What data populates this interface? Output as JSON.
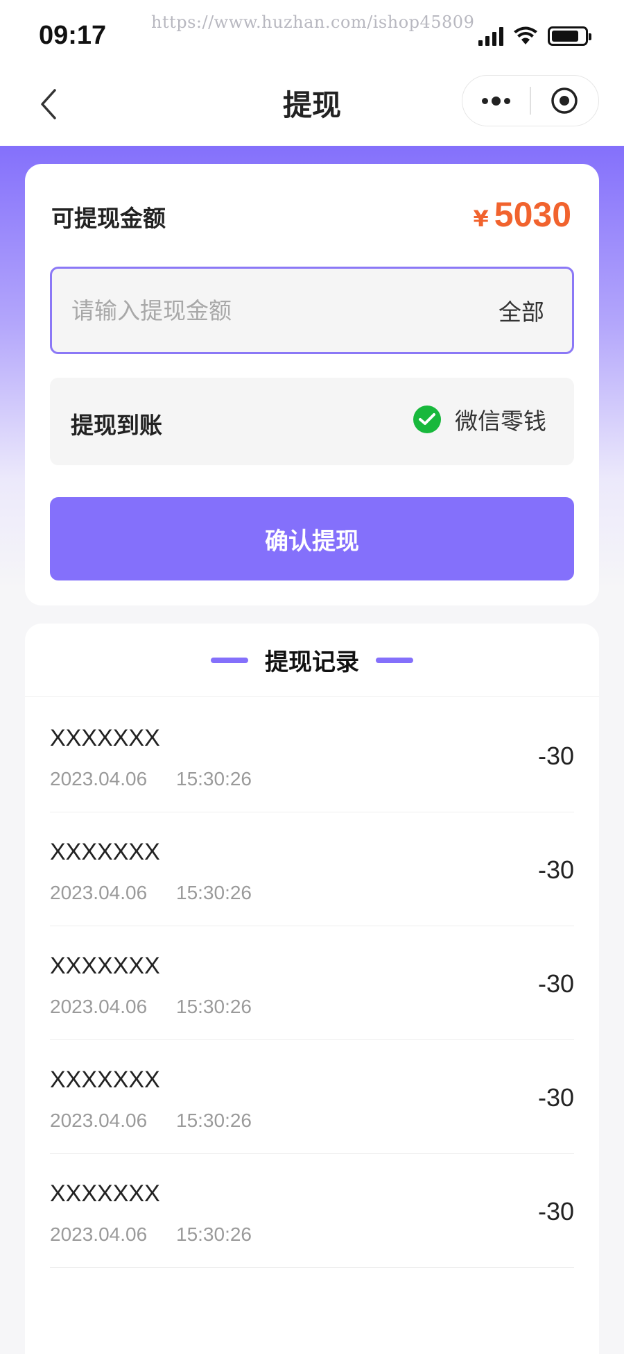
{
  "status_bar": {
    "time": "09:17",
    "watermark": "https://www.huzhan.com/ishop45809"
  },
  "nav": {
    "title": "提现"
  },
  "withdraw": {
    "available_label": "可提现金额",
    "currency_symbol": "¥",
    "available_amount": "5030",
    "amount_placeholder": "请输入提现金额",
    "amount_value": "",
    "all_label": "全部",
    "arrive_label": "提现到账",
    "arrive_method": "微信零钱",
    "confirm_label": "确认提现"
  },
  "records": {
    "title": "提现记录",
    "items": [
      {
        "name": "XXXXXXX",
        "date": "2023.04.06",
        "time": "15:30:26",
        "amount": "-30"
      },
      {
        "name": "XXXXXXX",
        "date": "2023.04.06",
        "time": "15:30:26",
        "amount": "-30"
      },
      {
        "name": "XXXXXXX",
        "date": "2023.04.06",
        "time": "15:30:26",
        "amount": "-30"
      },
      {
        "name": "XXXXXXX",
        "date": "2023.04.06",
        "time": "15:30:26",
        "amount": "-30"
      },
      {
        "name": "XXXXXXX",
        "date": "2023.04.06",
        "time": "15:30:26",
        "amount": "-30"
      }
    ]
  },
  "colors": {
    "accent": "#8470fb",
    "amount": "#f1632e",
    "wechat": "#18b83c"
  },
  "icons": {
    "back": "chevron-left-icon",
    "more": "more-dots-icon",
    "close": "target-circle-icon",
    "wechat": "wechat-icon",
    "signal": "signal-icon",
    "wifi": "wifi-icon",
    "battery": "battery-icon"
  }
}
